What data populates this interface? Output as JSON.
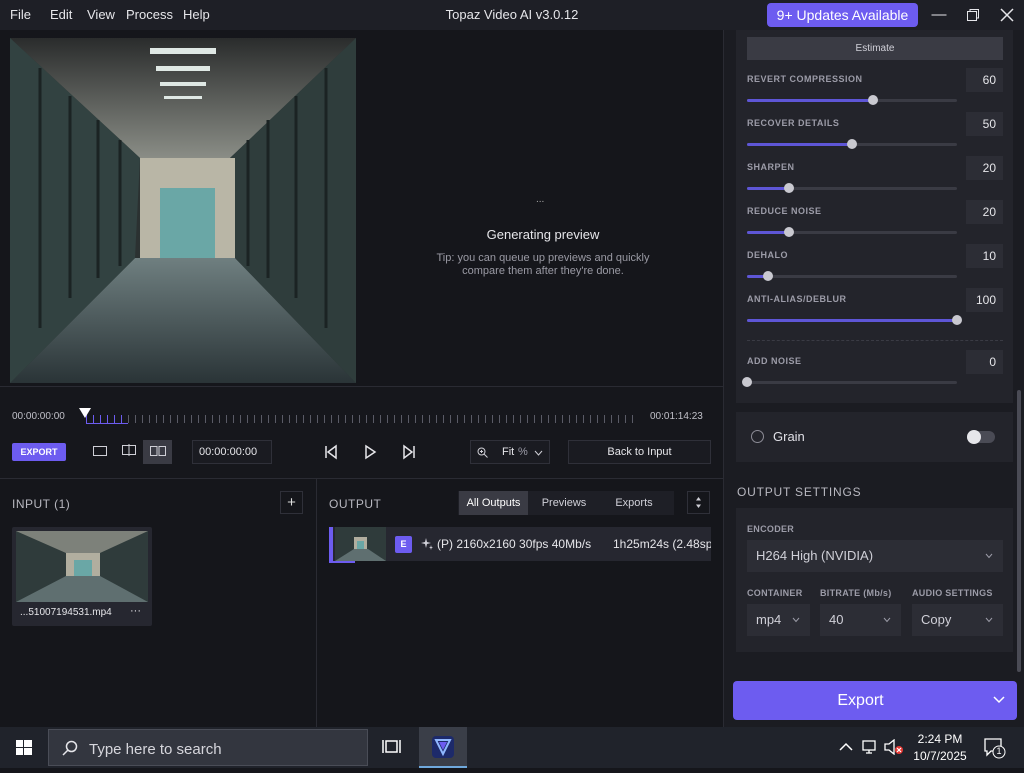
{
  "window": {
    "title": "Topaz Video AI  v3.0.12",
    "menu": [
      "File",
      "Edit",
      "View",
      "Process",
      "Help"
    ],
    "updates_label": "9+ Updates Available",
    "accent": "#6d5cf0"
  },
  "preview": {
    "status_dots": "...",
    "status_title": "Generating preview",
    "tip": "Tip: you can queue up previews and quickly compare them after they're done."
  },
  "timeline": {
    "start_time": "00:00:00:00",
    "end_time": "00:01:14:23",
    "export_label": "EXPORT",
    "current_timecode": "00:00:00:00",
    "zoom_label": "Fit",
    "zoom_unit": "%",
    "back_to_input_label": "Back to Input",
    "view_modes": [
      "single-view-icon",
      "split-view-icon",
      "side-by-side-view-icon"
    ]
  },
  "input_panel": {
    "title": "INPUT (1)",
    "add_label": "+",
    "file_name": "...51007194531.mp4",
    "more_label": "···"
  },
  "output_panel": {
    "title": "OUTPUT",
    "tabs": [
      "All Outputs",
      "Previews",
      "Exports"
    ],
    "row": {
      "badge": "E",
      "details": "(P)   2160x2160   30fps   40Mb/s",
      "duration": "1h25m24s (2.48sp"
    }
  },
  "enhancement": {
    "estimate_label": "Estimate",
    "sliders": [
      {
        "label": "REVERT COMPRESSION",
        "value": "60",
        "fraction": 0.6
      },
      {
        "label": "RECOVER DETAILS",
        "value": "50",
        "fraction": 0.5
      },
      {
        "label": "SHARPEN",
        "value": "20",
        "fraction": 0.2
      },
      {
        "label": "REDUCE NOISE",
        "value": "20",
        "fraction": 0.2
      },
      {
        "label": "DEHALO",
        "value": "10",
        "fraction": 0.1
      },
      {
        "label": "ANTI-ALIAS/DEBLUR",
        "value": "100",
        "fraction": 1.0
      },
      {
        "label": "ADD NOISE",
        "value": "0",
        "fraction": 0.0
      }
    ]
  },
  "grain": {
    "label": "Grain",
    "enabled": false
  },
  "output_settings": {
    "title": "OUTPUT SETTINGS",
    "encoder_label": "ENCODER",
    "encoder_value": "H264 High (NVIDIA)",
    "container_label": "CONTAINER",
    "container_value": "mp4",
    "bitrate_label": "BITRATE (Mb/s)",
    "bitrate_value": "40",
    "audio_label": "AUDIO SETTINGS",
    "audio_value": "Copy"
  },
  "export_button_label": "Export",
  "taskbar": {
    "search_placeholder": "Type here to search",
    "time": "2:24 PM",
    "date": "10/7/2025",
    "notification_count": "1"
  }
}
